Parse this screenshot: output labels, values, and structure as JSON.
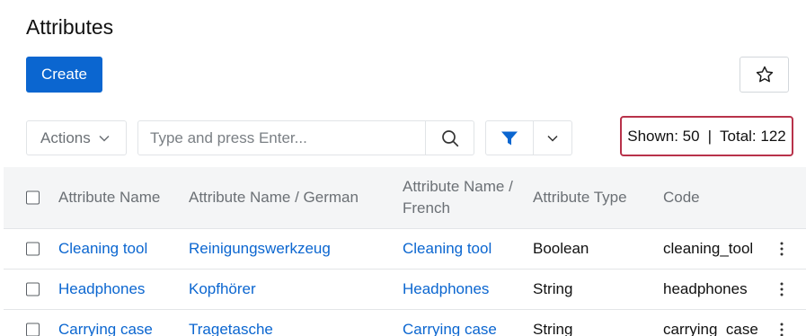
{
  "header": {
    "title": "Attributes",
    "create_label": "Create"
  },
  "toolbar": {
    "actions_label": "Actions",
    "search_placeholder": "Type and press Enter...",
    "shown_text": "Shown: 50",
    "separator": "|",
    "total_text": "Total: 122"
  },
  "table": {
    "columns": [
      "Attribute Name",
      "Attribute Name / German",
      "Attribute Name / French",
      "Attribute Type",
      "Code"
    ],
    "rows": [
      {
        "name": "Cleaning tool",
        "german": "Reinigungswerkzeug",
        "french": "Cleaning tool",
        "type": "Boolean",
        "code": "cleaning_tool"
      },
      {
        "name": "Headphones",
        "german": "Kopfhörer",
        "french": "Headphones",
        "type": "String",
        "code": "headphones"
      },
      {
        "name": "Carrying case",
        "german": "Tragetasche",
        "french": "Carrying case",
        "type": "String",
        "code": "carrying_case"
      }
    ]
  },
  "icons": {
    "star": "star-icon",
    "chevron": "chevron-down-icon",
    "search": "search-icon",
    "filter": "filter-icon",
    "kebab": "kebab-menu-icon"
  },
  "colors": {
    "primary": "#0b66d0",
    "highlight_border": "#b8324a",
    "header_bg": "#f4f5f6"
  }
}
